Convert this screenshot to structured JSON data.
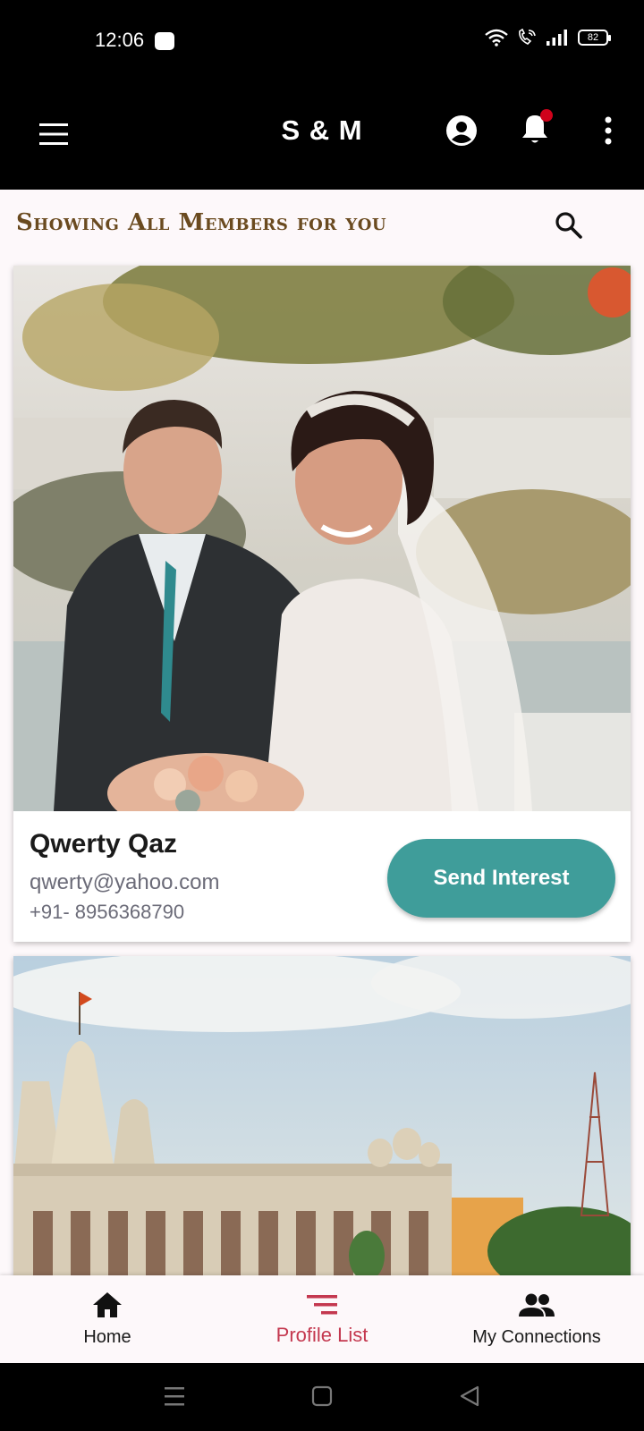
{
  "status_bar": {
    "time": "12:06",
    "battery": "82"
  },
  "app_bar": {
    "title": "S & M",
    "icons": [
      "menu-icon",
      "account-circle-icon",
      "notification-bell-icon",
      "more-vert-icon"
    ],
    "has_notification_badge": true
  },
  "section": {
    "title": "Showing All Members for you",
    "search_icon": "search-icon"
  },
  "members": [
    {
      "name": "Qwerty Qaz",
      "email": "qwerty@yahoo.com",
      "phone": "+91- 8956368790",
      "action_label": "Send Interest"
    }
  ],
  "bottom_nav": {
    "items": [
      {
        "label": "Home",
        "icon": "home-icon"
      },
      {
        "label": "Profile List",
        "icon": "list-icon",
        "active": true
      },
      {
        "label": "My Connections",
        "icon": "people-icon"
      }
    ]
  },
  "colors": {
    "accent": "#3f9d9a",
    "active_nav": "#c4384f",
    "title_brown": "#6a4a1f",
    "app_bar": "#000000",
    "badge": "#d0021b"
  }
}
